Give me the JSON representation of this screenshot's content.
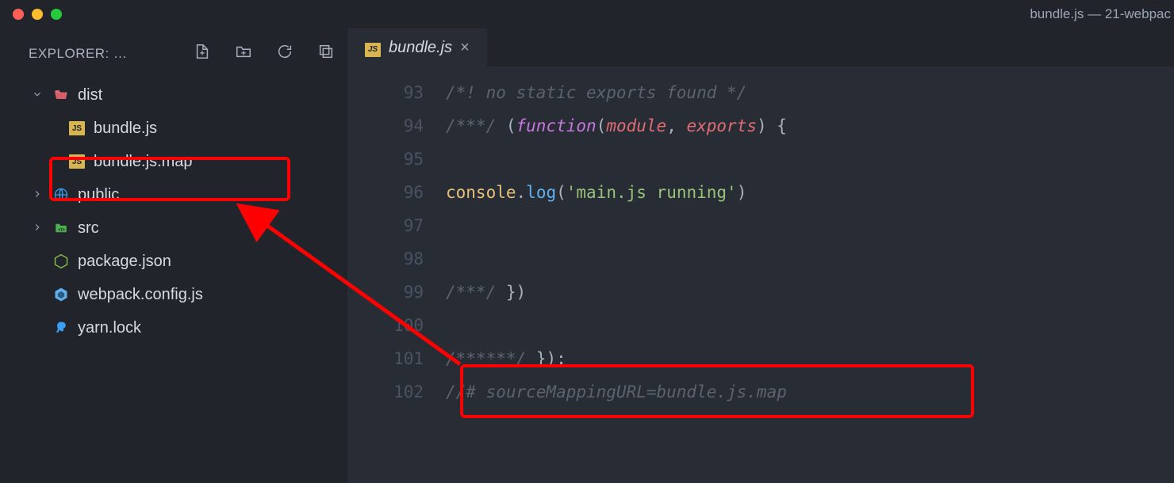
{
  "titlebar": {
    "title": "bundle.js — 21-webpac"
  },
  "sidebar": {
    "title": "EXPLORER: …",
    "tree": {
      "dist": {
        "label": "dist",
        "bundle_js": "bundle.js",
        "bundle_js_map": "bundle.js.map"
      },
      "public": "public",
      "src": "src",
      "package_json": "package.json",
      "webpack_config": "webpack.config.js",
      "yarn_lock": "yarn.lock"
    }
  },
  "editor": {
    "tab_label": "bundle.js",
    "tab_close": "×",
    "lines": {
      "n93": "93",
      "n94": "94",
      "n95": "95",
      "n96": "96",
      "n97": "97",
      "n98": "98",
      "n99": "99",
      "n100": "100",
      "n101": "101",
      "n102": "102"
    },
    "code": {
      "l93": "/*! no static exports found */",
      "l94_a": "/***/",
      "l94_b": " (",
      "l94_c": "function",
      "l94_d": "(",
      "l94_e": "module",
      "l94_f": ", ",
      "l94_g": "exports",
      "l94_h": ") {",
      "l96_a": "console",
      "l96_b": ".",
      "l96_c": "log",
      "l96_d": "(",
      "l96_e": "'main.js running'",
      "l96_f": ")",
      "l99_a": "/***/",
      "l99_b": " })",
      "l101_a": "/******/",
      "l101_b": " });",
      "l102": "//# sourceMappingURL=bundle.js.map"
    }
  }
}
